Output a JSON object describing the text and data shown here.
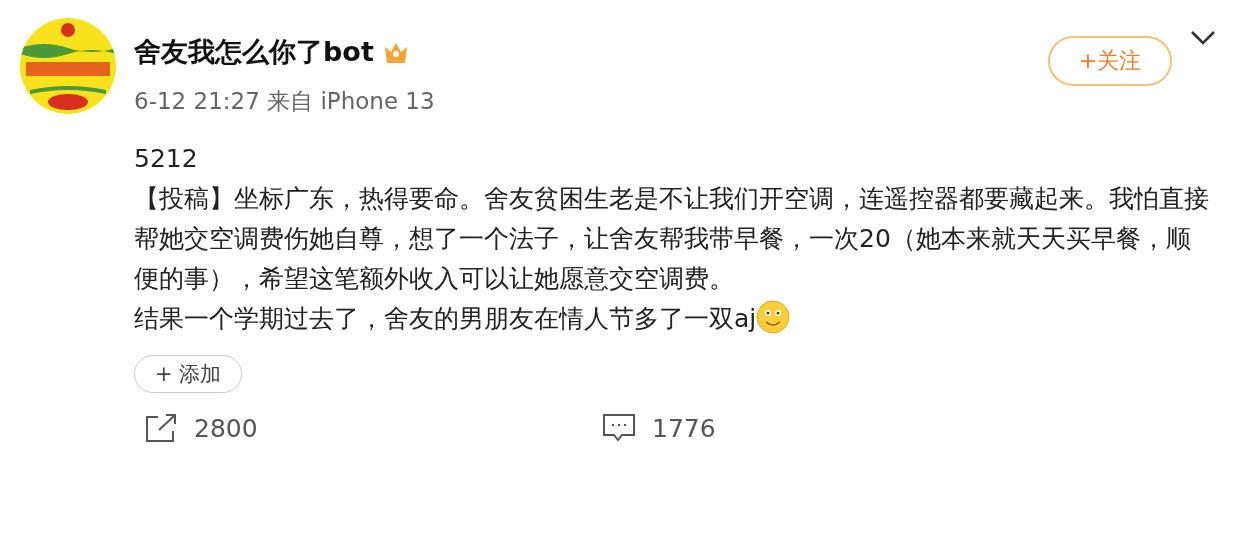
{
  "author": {
    "name": "舍友我怎么你了bot",
    "meta": "6-12 21:27 来自 iPhone 13"
  },
  "follow_button": "+关注",
  "post": {
    "lines": [
      "5212",
      "【投稿】坐标广东，热得要命。舍友贫困生老是不让我们开空调，连遥控器都要藏起来。我怕直接帮她交空调费伤她自尊，想了一个法子，让舍友帮我带早餐，一次20（她本来就天天买早餐，顺便的事），希望这笔额外收入可以让她愿意交空调费。",
      "结果一个学期过去了，舍友的男朋友在情人节多了一双aj"
    ]
  },
  "add_button": "+ 添加",
  "actions": [
    {
      "kind": "share",
      "count": "2800"
    },
    {
      "kind": "comment",
      "count": "1776"
    }
  ]
}
